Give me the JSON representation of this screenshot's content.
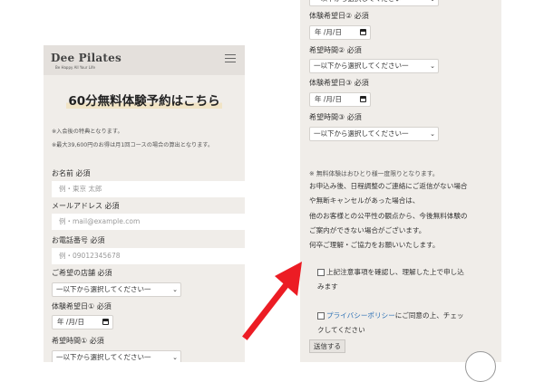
{
  "left": {
    "brand": "Dee Pilates",
    "tagline": "Be Happy All Your Life",
    "title": "60分無料体験予約はこちら",
    "note1": "※入会後の特典となります。",
    "note2": "※最大39,600円のお得は月1回コースの場合の算出となります。",
    "name_label": "お名前 必須",
    "name_placeholder": "例・東京 太郎",
    "email_label": "メールアドレス 必須",
    "email_placeholder": "例・mail@example.com",
    "phone_label": "お電話番号 必須",
    "phone_placeholder": "例・09012345678",
    "store_label": "ご希望の店舗 必須",
    "select_text": "一以下から選択してください一",
    "date1_label": "体験希望日① 必須",
    "date_text": "年 /月/日",
    "time1_label": "希望時間① 必須"
  },
  "right": {
    "date2_label": "体験希望日② 必須",
    "time2_label": "希望時間② 必須",
    "date3_label": "体験希望日③ 必須",
    "time3_label": "希望時間③ 必須",
    "select_text": "一以下から選択してください一",
    "date_text": "年 /月/日",
    "note": "※ 無料体験はおひとり様一度限りとなります。",
    "para1": "お申込み後、日程調整のご連絡にご返信がない場合",
    "para2": "や無断キャンセルがあった場合は、",
    "para3": "他のお客様との公平性の観点から、今後無料体験の",
    "para4": "ご案内ができない場合がございます。",
    "para5": "何卒ご理解・ご協力をお願いいたします。",
    "check1_line1": "上記注意事項を確認し、理解した上で申し込",
    "check1_line2": "みます",
    "check2_link": "プライバシーポリシー",
    "check2_rest": "にご同意の上、チェッ",
    "check2_line2": "クしてください",
    "submit": "送信する"
  },
  "colors": {
    "background": "#f0ede9",
    "header": "#e4e0dc",
    "arrow": "#ec1c24",
    "link": "#2a6fb5"
  }
}
